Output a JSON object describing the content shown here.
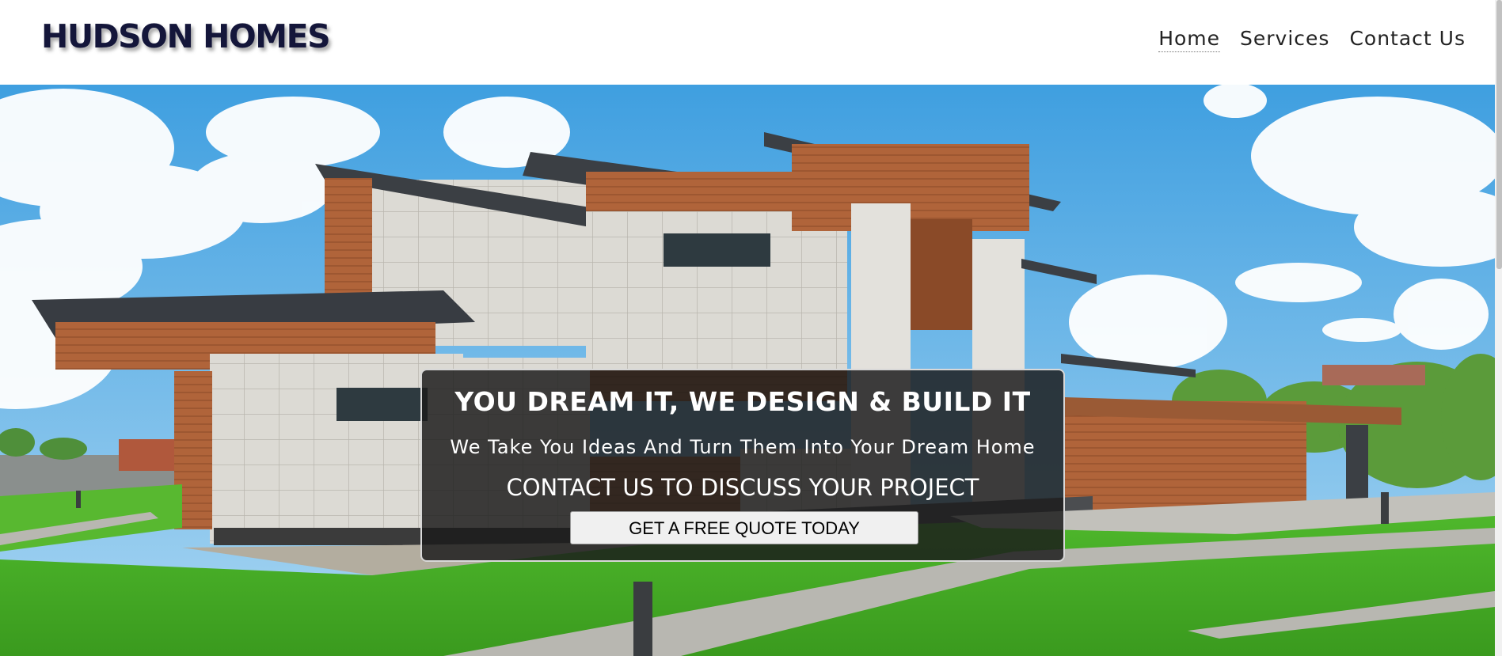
{
  "header": {
    "logo": "HUDSON HOMES",
    "nav": [
      {
        "label": "Home",
        "active": true
      },
      {
        "label": "Services",
        "active": false
      },
      {
        "label": "Contact Us",
        "active": false
      }
    ]
  },
  "hero": {
    "image": "modern-house-photo",
    "headline": "YOU DREAM IT, WE DESIGN & BUILD IT",
    "subline": "We Take You Ideas And Turn Them Into Your Dream Home",
    "cta_text": "CONTACT US TO DISCUSS YOUR PROJECT",
    "cta_button": "GET A FREE QUOTE TODAY"
  },
  "colors": {
    "logo": "#14163a",
    "overlay": "#1c1c1c",
    "button": "#f0f0f0"
  }
}
